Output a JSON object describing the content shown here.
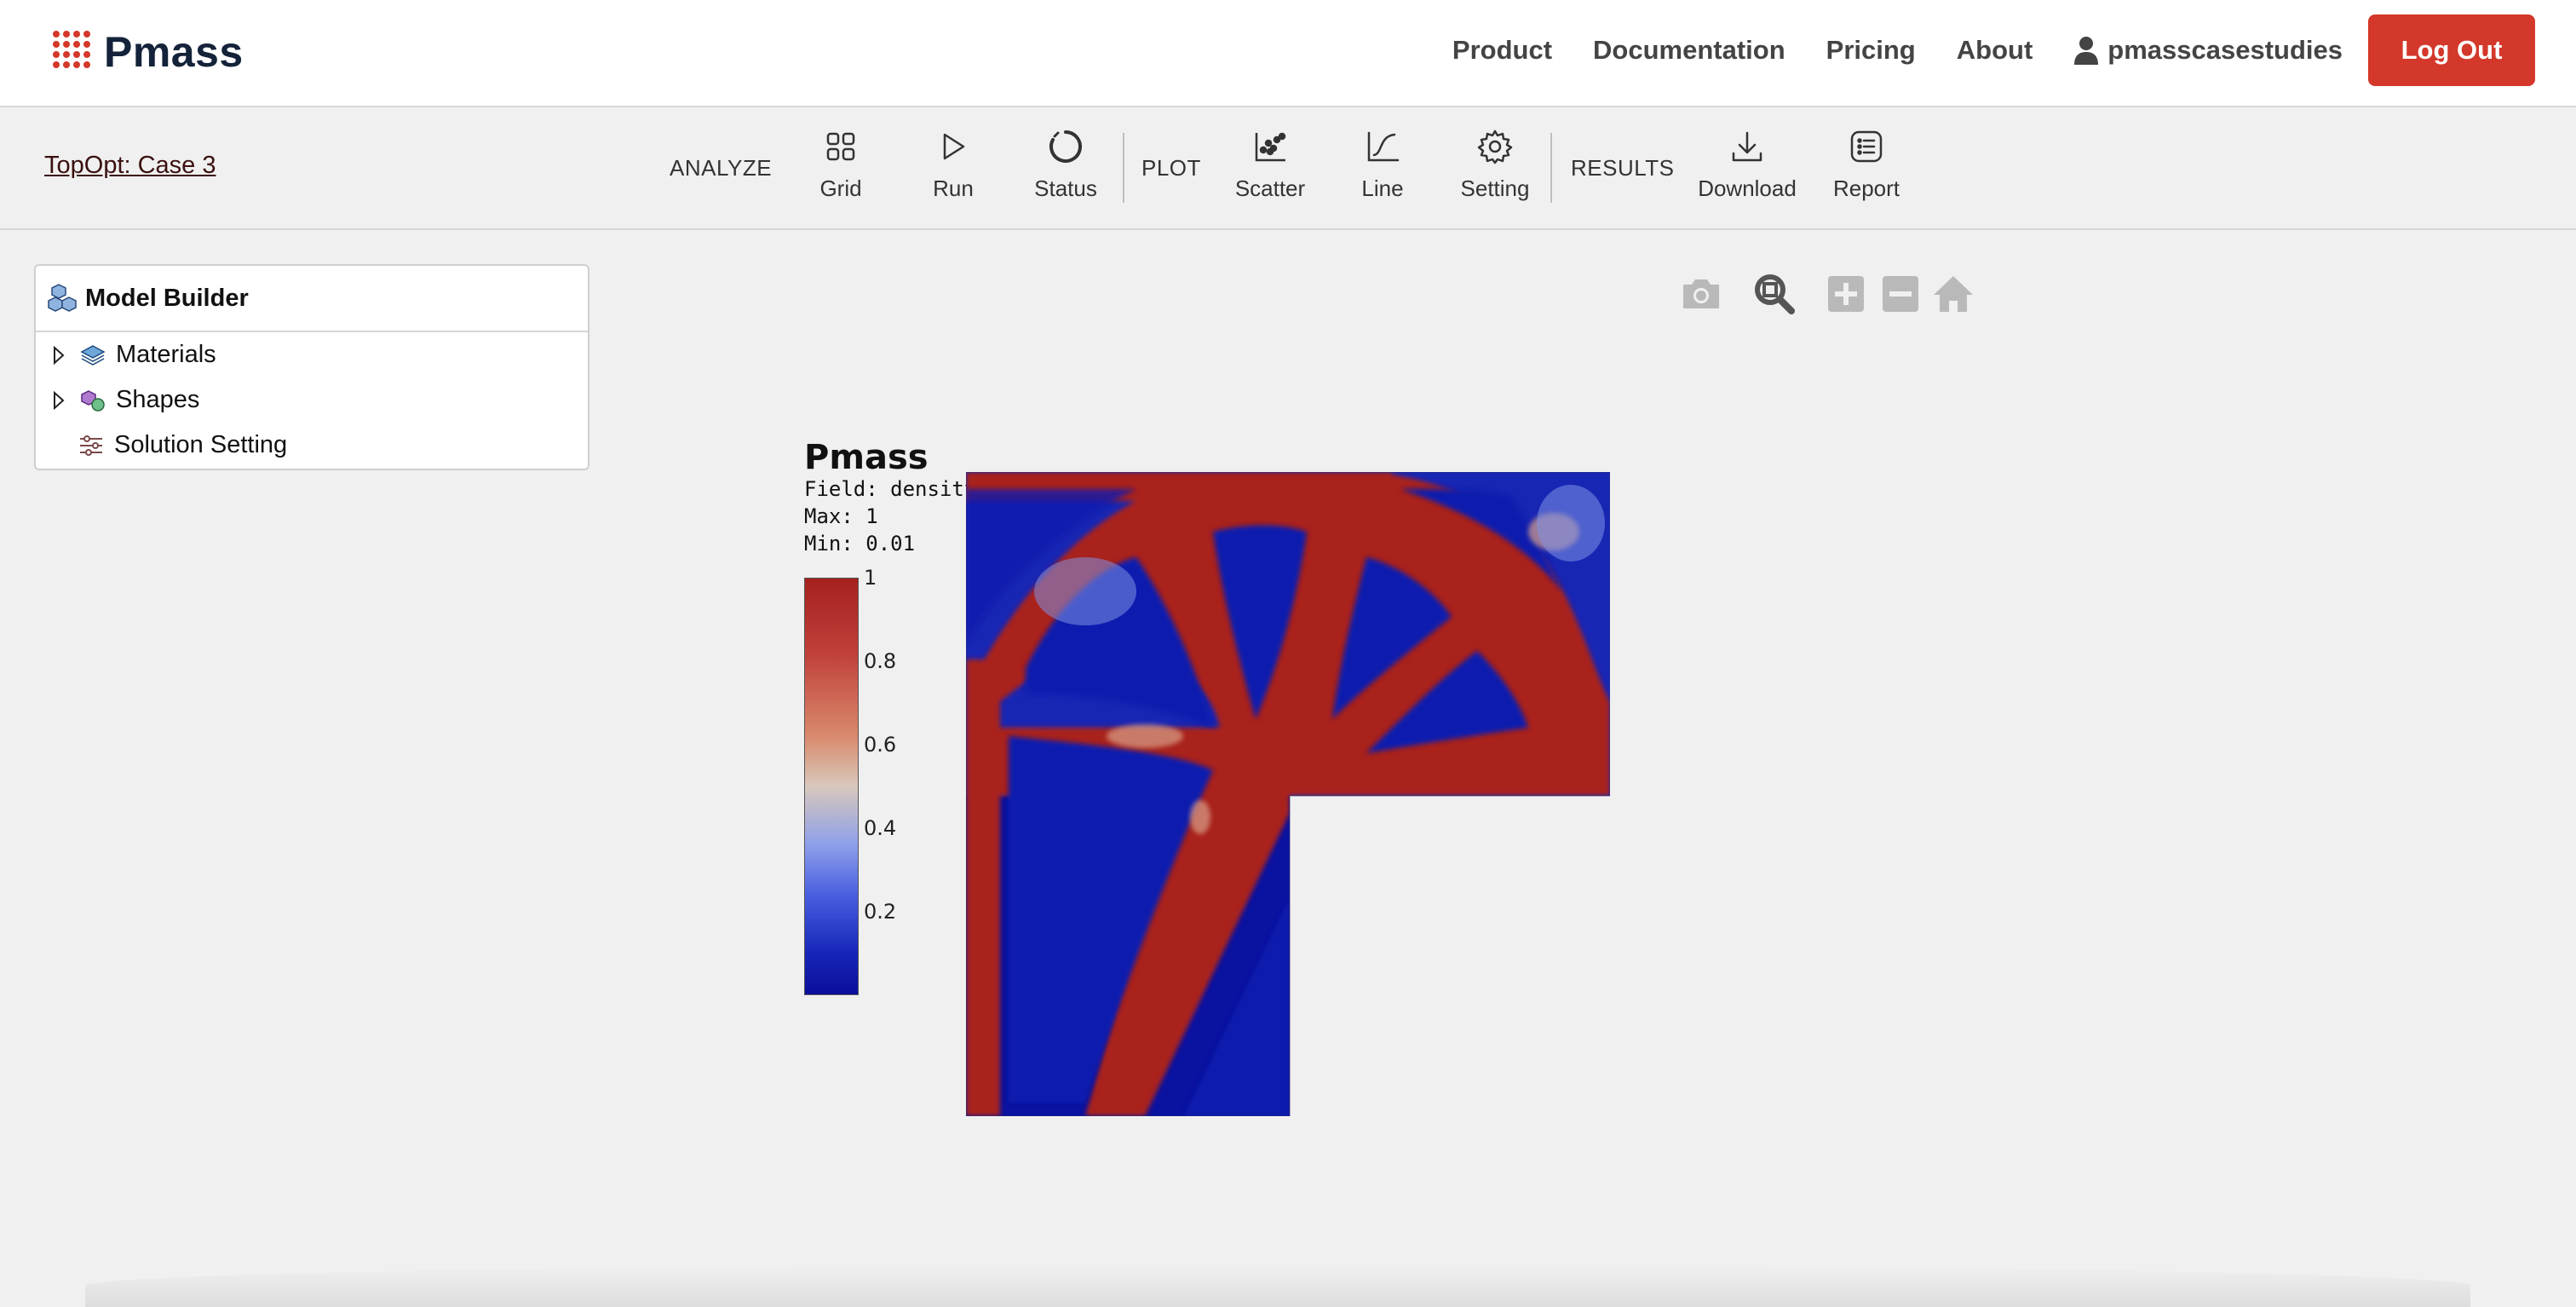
{
  "brand": {
    "name": "Pmass"
  },
  "nav": {
    "items": [
      "Product",
      "Documentation",
      "Pricing",
      "About"
    ],
    "user": "pmasscasestudies",
    "logout": "Log Out"
  },
  "toolbar": {
    "case_title": "TopOpt: Case 3",
    "analyze_label": "ANALYZE",
    "plot_label": "PLOT",
    "results_label": "RESULTS",
    "buttons": {
      "grid": "Grid",
      "run": "Run",
      "status": "Status",
      "scatter": "Scatter",
      "line": "Line",
      "setting": "Setting",
      "download": "Download",
      "report": "Report"
    }
  },
  "model_builder": {
    "title": "Model Builder",
    "items": [
      "Materials",
      "Shapes",
      "Solution Setting"
    ]
  },
  "viewer": {
    "icons": [
      "camera-icon",
      "zoom-box-icon",
      "zoom-in-icon",
      "zoom-out-icon",
      "home-icon"
    ]
  },
  "plot": {
    "title": "Pmass",
    "field": "Field: density-continuous",
    "max": "Max: 1",
    "min": "Min: 0.01",
    "colorbar_ticks": [
      "1",
      "0.8",
      "0.6",
      "0.4",
      "0.2"
    ],
    "colors": {
      "high": "#a5211e",
      "low": "#0a0f9a"
    }
  }
}
